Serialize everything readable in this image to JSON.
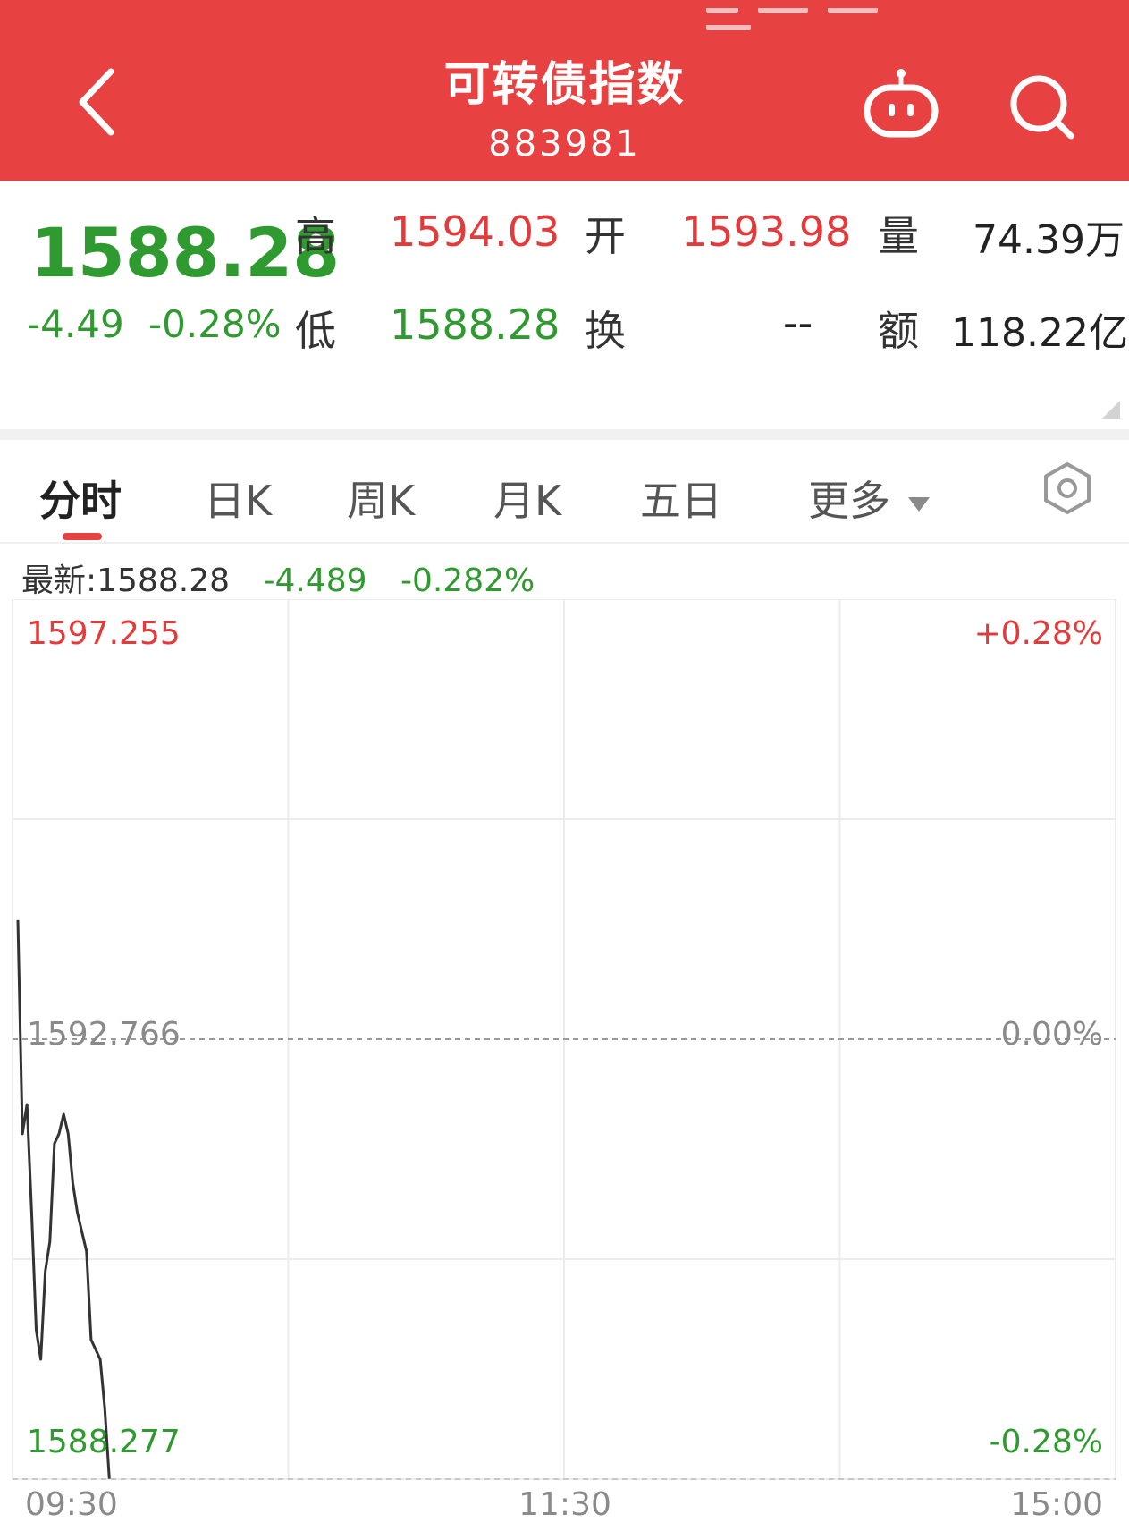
{
  "header": {
    "title": "可转债指数",
    "code": "883981"
  },
  "quote": {
    "price": "1588.28",
    "change": "-4.49",
    "change_pct": "-0.28%",
    "high_label": "高",
    "high": "1594.03",
    "low_label": "低",
    "low": "1588.28",
    "open_label": "开",
    "open": "1593.98",
    "turnover_label": "换",
    "turnover": "--",
    "volume_label": "量",
    "volume": "74.39万",
    "amount_label": "额",
    "amount": "118.22亿"
  },
  "tabs": [
    {
      "label": "分时",
      "active": true
    },
    {
      "label": "日K",
      "active": false
    },
    {
      "label": "周K",
      "active": false
    },
    {
      "label": "月K",
      "active": false
    },
    {
      "label": "五日",
      "active": false
    },
    {
      "label": "更多",
      "active": false
    }
  ],
  "latest": {
    "label": "最新:1588.28",
    "change": "-4.489",
    "change_pct": "-0.282%"
  },
  "colors": {
    "header": "#e84141",
    "up": "#e33b3b",
    "down": "#2f9a2f",
    "line": "#333333"
  },
  "chart_data": {
    "type": "line",
    "title": "",
    "x_tick_labels": [
      "09:30",
      "11:30",
      "15:00"
    ],
    "y_left_labels": {
      "top": "1597.255",
      "mid": "1592.766",
      "bottom": "1588.277"
    },
    "y_right_labels": {
      "top": "+0.28%",
      "mid": "0.00%",
      "bottom": "-0.28%"
    },
    "ylim": [
      1588.277,
      1597.255
    ],
    "reference_price": 1592.766,
    "total_minutes": 240,
    "series": [
      {
        "minute": [
          0,
          1,
          2,
          3,
          4,
          5,
          6,
          7,
          8,
          9,
          10,
          11,
          12,
          13,
          14,
          15,
          16,
          17,
          18,
          19,
          20
        ],
        "values": [
          1593.98,
          1591.8,
          1592.1,
          1591.0,
          1589.8,
          1589.5,
          1590.4,
          1590.7,
          1591.7,
          1591.8,
          1592.0,
          1591.8,
          1591.3,
          1591.0,
          1590.8,
          1590.6,
          1589.7,
          1589.6,
          1589.5,
          1589.0,
          1588.28
        ]
      }
    ]
  }
}
